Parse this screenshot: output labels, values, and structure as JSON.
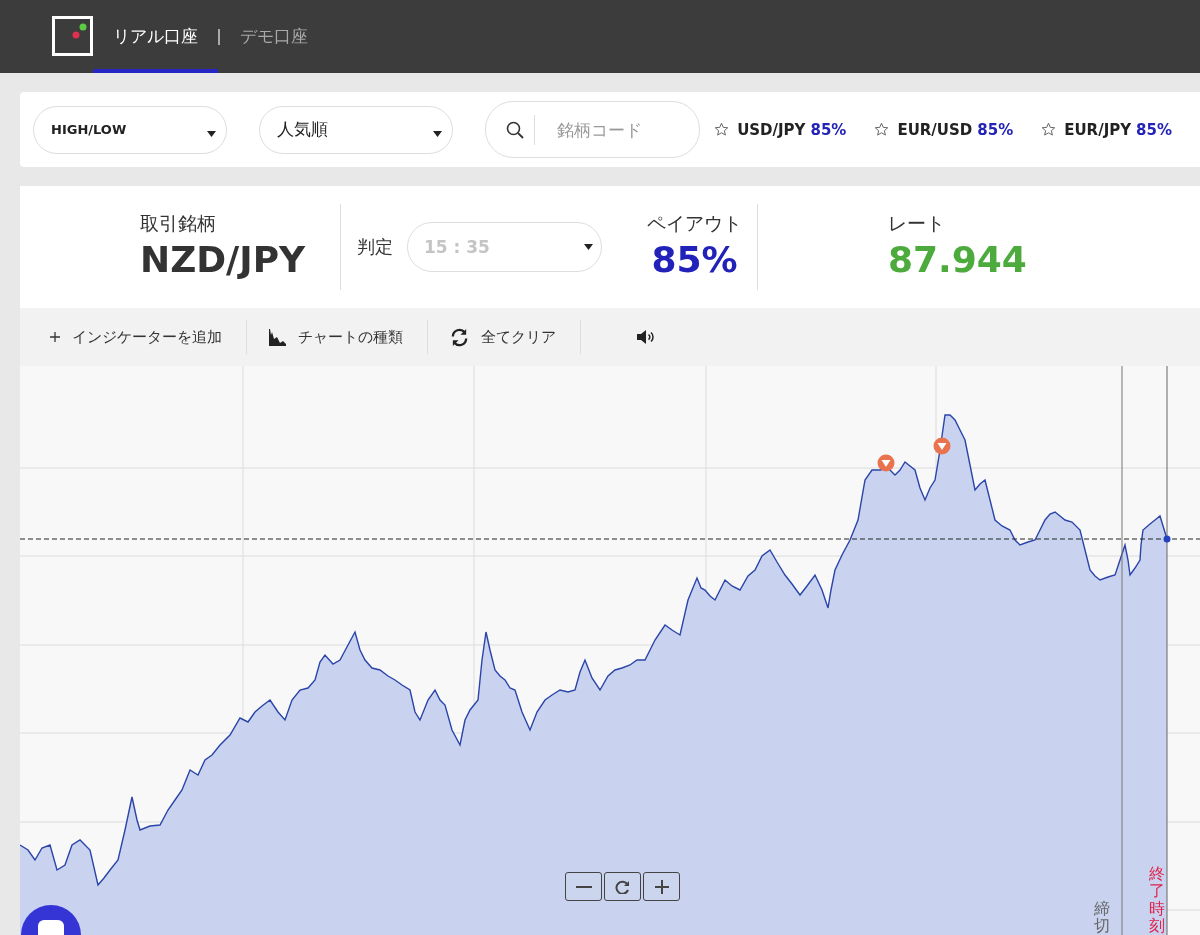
{
  "header": {
    "tabs": [
      {
        "label": "リアル口座",
        "selected": true
      },
      {
        "label": "デモ口座",
        "selected": false
      }
    ]
  },
  "filters": {
    "type_select": "HIGH/LOW",
    "sort_select": "人気順",
    "search": {
      "placeholder": "銘柄コード"
    },
    "favorites": [
      {
        "pair": "USD/JPY",
        "payout": "85%"
      },
      {
        "pair": "EUR/USD",
        "payout": "85%"
      },
      {
        "pair": "EUR/JPY",
        "payout": "85%"
      }
    ]
  },
  "summary": {
    "symbol_label": "取引銘柄",
    "symbol": "NZD/JPY",
    "expiry_label": "判定",
    "expiry": {
      "value": "15 : 35",
      "disabled": true
    },
    "payout_label": "ペイアウト",
    "payout": "85%",
    "rate_label": "レート",
    "rate": "87.944"
  },
  "toolbar": [
    {
      "kind": "add",
      "label": "インジケーターを追加"
    },
    {
      "kind": "chart-type",
      "label": "チャートの種類"
    },
    {
      "kind": "clear",
      "label": "全てクリア"
    },
    {
      "kind": "sound"
    }
  ],
  "chart": {
    "deadline_label": "締切",
    "end_label": "終了時刻",
    "zoom_controls": [
      {
        "kind": "zoom-out"
      },
      {
        "kind": "reset"
      },
      {
        "kind": "zoom-in"
      }
    ]
  }
}
